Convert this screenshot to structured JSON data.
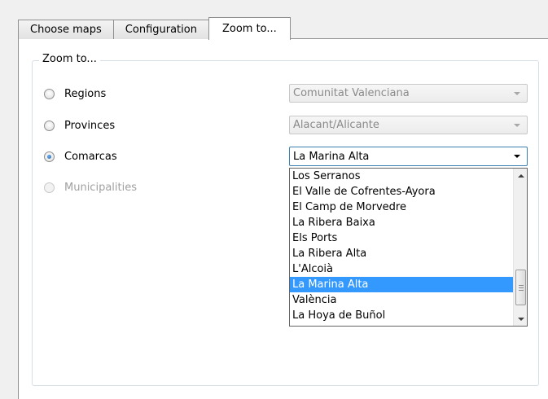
{
  "tabs": [
    {
      "label": "Choose maps",
      "active": false
    },
    {
      "label": "Configuration",
      "active": false
    },
    {
      "label": "Zoom to...",
      "active": true
    }
  ],
  "group": {
    "title": "Zoom to..."
  },
  "options": {
    "regions": {
      "label": "Regions",
      "checked": false,
      "enabled": true,
      "combo_value": "Comunitat Valenciana"
    },
    "provinces": {
      "label": "Provinces",
      "checked": false,
      "enabled": true,
      "combo_value": "Alacant/Alicante"
    },
    "comarcas": {
      "label": "Comarcas",
      "checked": true,
      "enabled": true,
      "combo_value": "La Marina Alta"
    },
    "municipalities": {
      "label": "Municipalities",
      "checked": false,
      "enabled": false
    }
  },
  "dropdown": {
    "items": [
      "Los Serranos",
      "El Valle de Cofrentes-Ayora",
      "El Camp de Morvedre",
      "La Ribera Baixa",
      "Els Ports",
      "La Ribera Alta",
      "L'Alcoià",
      "La Marina Alta",
      "València",
      "La Hoya de Buñol"
    ],
    "selected_index": 7
  },
  "colors": {
    "selection": "#3399ff",
    "active_border": "#3c7fb1"
  }
}
